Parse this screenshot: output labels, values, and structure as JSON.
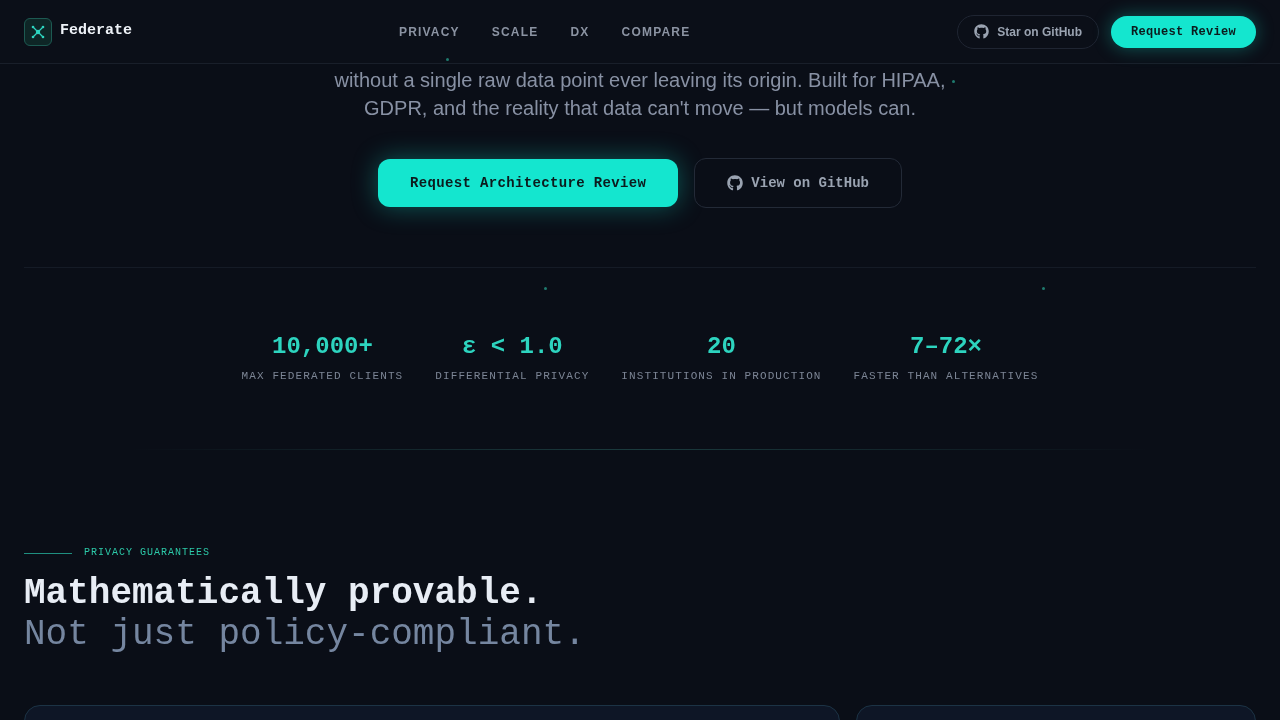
{
  "header": {
    "logo_text": "Federate",
    "nav": [
      "PRIVACY",
      "SCALE",
      "DX",
      "COMPARE"
    ],
    "actions": [
      {
        "label": "Star on GitHub",
        "kind": "secondary"
      },
      {
        "label": "Request Review",
        "kind": "primary"
      }
    ]
  },
  "hero": {
    "text": "without a single raw data point ever leaving its origin. Built for HIPAA, GDPR, and the reality that data can't move — but models can.",
    "buttons": [
      {
        "label": "Request Architecture Review",
        "kind": "primary"
      },
      {
        "label": "View on GitHub",
        "kind": "secondary"
      }
    ]
  },
  "stats": [
    {
      "value": "10,000+",
      "label": "MAX FEDERATED CLIENTS"
    },
    {
      "value": "ε < 1.0",
      "label": "DIFFERENTIAL PRIVACY"
    },
    {
      "value": "20",
      "label": "INSTITUTIONS IN PRODUCTION"
    },
    {
      "value": "7–72×",
      "label": "FASTER THAN ALTERNATIVES"
    }
  ],
  "section": {
    "eyebrow": "PRIVACY GUARANTEES",
    "heading": "Mathematically provable.",
    "subheading": "Not just policy-compliant."
  }
}
